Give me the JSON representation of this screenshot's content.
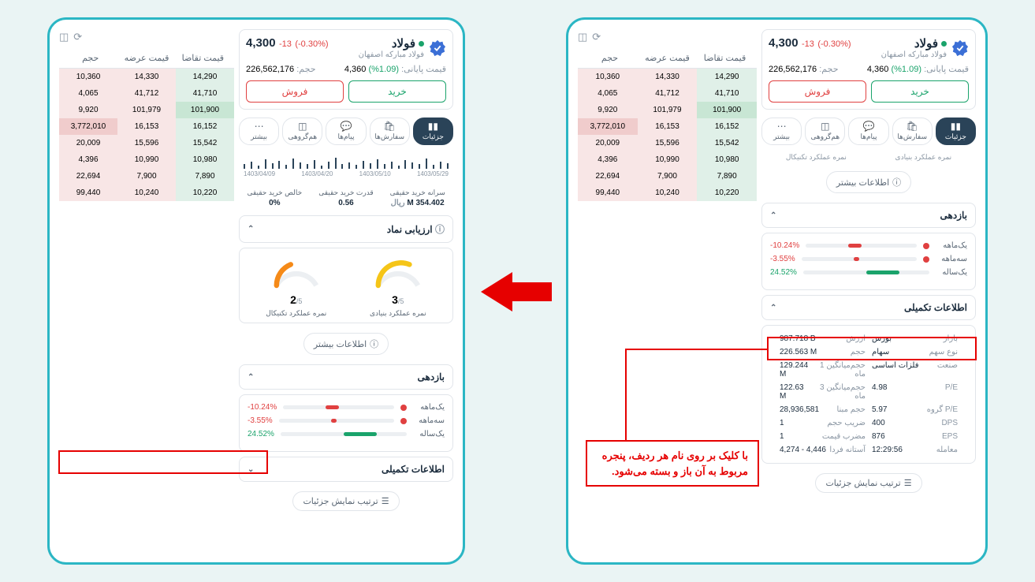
{
  "symbol": {
    "name": "فولاد",
    "subtitle": "فولاد مبارکه اصفهان",
    "last_price": "4,300",
    "change": "-13",
    "change_pct": "(-0.30%)",
    "closing_label": "قیمت پایانی:",
    "closing_value": "4,360",
    "closing_pct": "(1.09%)",
    "volume_label": "حجم:",
    "volume": "226,562,176"
  },
  "buttons": {
    "buy": "خرید",
    "sell": "فروش"
  },
  "tabs": {
    "details": "جزئیات",
    "orders": "سفارش‌ها",
    "messages": "پیام‌ها",
    "cogroup": "هم‌گروهی",
    "more": "بیشتر"
  },
  "orderbook": {
    "headers": {
      "demand": "قیمت تقاضا",
      "supply": "قیمت عرضه",
      "vol": "حجم"
    },
    "rows": [
      {
        "d": "14,290",
        "s": "14,330",
        "v": "10,360"
      },
      {
        "d": "41,710",
        "s": "41,712",
        "v": "4,065"
      },
      {
        "d": "101,900",
        "s": "101,979",
        "v": "9,920"
      },
      {
        "d": "16,152",
        "s": "16,153",
        "v": "3,772,010"
      },
      {
        "d": "15,542",
        "s": "15,596",
        "v": "20,009"
      },
      {
        "d": "10,980",
        "s": "10,990",
        "v": "4,396"
      },
      {
        "d": "7,890",
        "s": "7,900",
        "v": "22,694"
      },
      {
        "d": "10,220",
        "s": "10,240",
        "v": "99,440"
      }
    ]
  },
  "scores": {
    "fundamental_label": "نمره عملکرد بنیادی",
    "technical_label": "نمره عملکرد تکنیکال",
    "f_score": "3",
    "t_score": "2",
    "suffix": "/5",
    "eval_title": "ارزیابی نماد",
    "more_info": "اطلاعات بیشتر"
  },
  "spark": {
    "dates": [
      "1403/04/09",
      "1403/04/20",
      "1403/05/10",
      "1403/05/29"
    ]
  },
  "metrics": {
    "m1_l": "سرانه خرید حقیقی",
    "m1_v": "354.402 M",
    "m1_u": "ریال",
    "m2_l": "قدرت خرید حقیقی",
    "m2_v": "0.56",
    "m3_l": "خالص خرید حقیقی",
    "m3_v": "0%"
  },
  "returns": {
    "title": "بازدهی",
    "m1_l": "یک‌ماهه",
    "m1_v": "-10.24%",
    "m3_l": "سه‌ماهه",
    "m3_v": "-3.55%",
    "y1_l": "یک‌ساله",
    "y1_v": "24.52%"
  },
  "info": {
    "title": "اطلاعات تکمیلی",
    "rows": [
      {
        "k1": "بازار",
        "v1": "بورس",
        "k2": "ارزش",
        "v2": "987.718 B"
      },
      {
        "k1": "نوع سهم",
        "v1": "سهام",
        "k2": "حجم",
        "v2": "226.563 M"
      },
      {
        "k1": "صنعت",
        "v1": "فلزات اساسی",
        "k2": "حجم‌میانگین 1 ماه",
        "v2": "129.244 M"
      },
      {
        "k1": "P/E",
        "v1": "4.98",
        "k2": "حجم‌میانگین 3 ماه",
        "v2": "122.63 M"
      },
      {
        "k1": "P/E گروه",
        "v1": "5.97",
        "k2": "حجم مبنا",
        "v2": "28,936,581"
      },
      {
        "k1": "DPS",
        "v1": "400",
        "k2": "ضریب حجم",
        "v2": "1"
      },
      {
        "k1": "EPS",
        "v1": "876",
        "k2": "مضرب قیمت",
        "v2": "1"
      },
      {
        "k1": "معامله",
        "v1": "12:29:56",
        "k2": "آستانه فردا",
        "v2": "4,274 - 4,446"
      }
    ]
  },
  "footer": {
    "order_label": "ترتیب نمایش جزئیات"
  },
  "callout": {
    "l1": "با کلیک بر روی نام هر ردیف، پنجره",
    "l2": "مربوط به آن باز و بسته می‌شود."
  }
}
